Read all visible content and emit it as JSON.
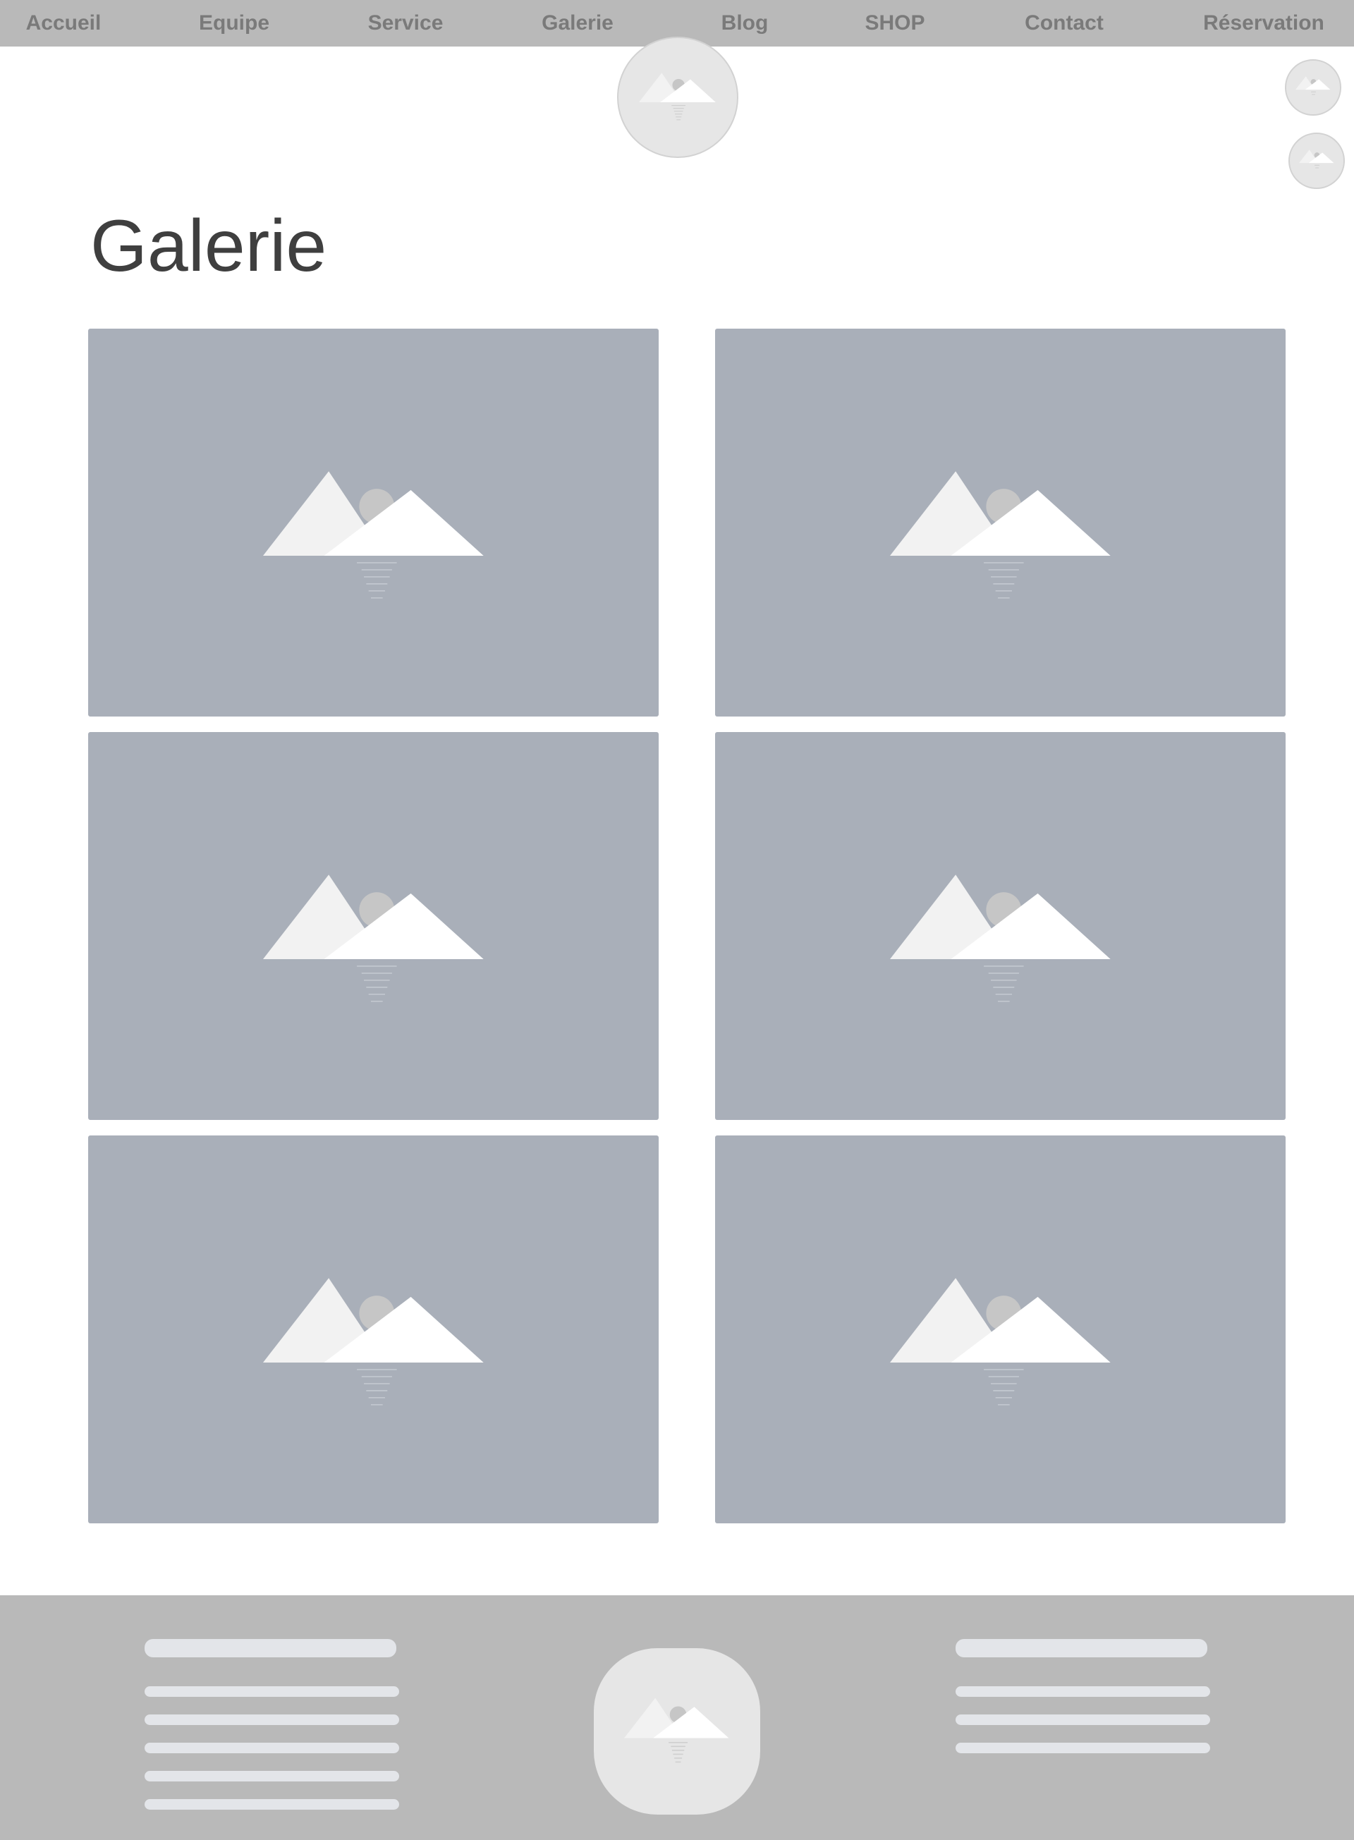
{
  "nav": {
    "items": [
      {
        "label": "Accueil"
      },
      {
        "label": "Equipe"
      },
      {
        "label": "Service"
      },
      {
        "label": "Galerie"
      },
      {
        "label": "Blog"
      },
      {
        "label": "SHOP"
      },
      {
        "label": "Contact"
      },
      {
        "label": "Réservation"
      }
    ]
  },
  "header": {
    "logo_icon": "image-placeholder-icon",
    "social_icons": [
      "image-placeholder-icon",
      "image-placeholder-icon"
    ]
  },
  "main": {
    "title": "Galerie",
    "gallery": [
      {
        "icon": "image-placeholder-icon"
      },
      {
        "icon": "image-placeholder-icon"
      },
      {
        "icon": "image-placeholder-icon"
      },
      {
        "icon": "image-placeholder-icon"
      },
      {
        "icon": "image-placeholder-icon"
      },
      {
        "icon": "image-placeholder-icon"
      }
    ]
  },
  "footer": {
    "logo_icon": "image-placeholder-icon"
  },
  "colors": {
    "nav_background": "#b9b9b9",
    "nav_text": "#7a7a7a",
    "gallery_placeholder": "#a9afb9",
    "footer_background": "#b9b9b9",
    "footer_text_placeholder": "#e3e5e9",
    "title_text": "#3f3f3f"
  }
}
